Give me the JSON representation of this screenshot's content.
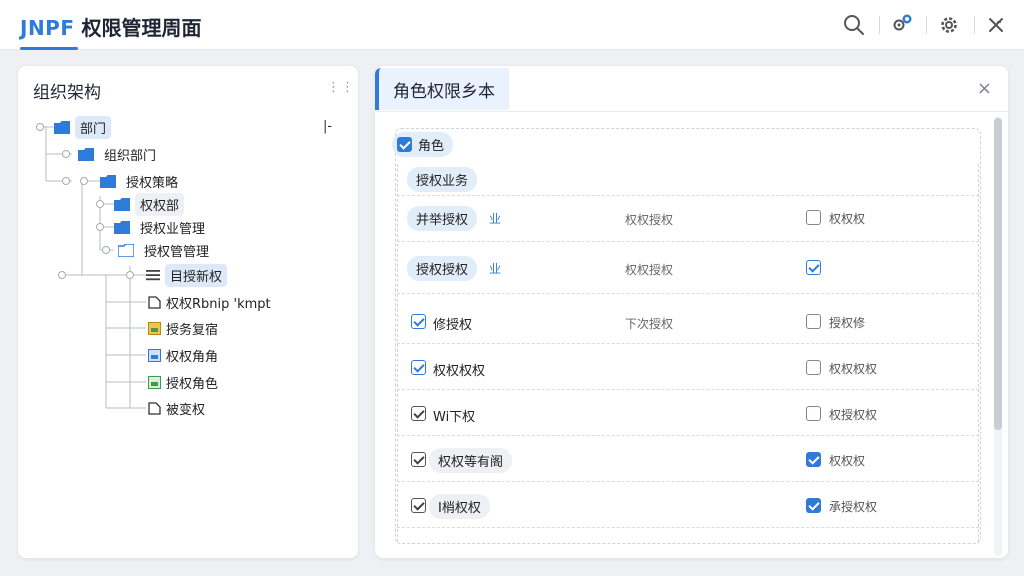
{
  "app": {
    "logo": "JNPF",
    "title": "权限管理周面"
  },
  "header_icons": [
    "search-icon",
    "notification-icon",
    "settings-icon",
    "collapse-icon"
  ],
  "left_panel": {
    "title": "组织架构",
    "more": "⋮⋮",
    "toggle": "|-",
    "nodes": [
      {
        "label": "部门",
        "icon": "folder-icon"
      },
      {
        "label": "组织部门",
        "icon": "folder-icon"
      },
      {
        "label": "授权策略",
        "icon": "folder-icon"
      },
      {
        "label": "权权部",
        "icon": "folder-icon"
      },
      {
        "label": "授权业管理",
        "icon": "folder-icon"
      },
      {
        "label": "授权管管理",
        "icon": "folder-open-icon"
      },
      {
        "label": "目授新权",
        "icon": "list-icon"
      },
      {
        "label": "权权Rbnip 'kmpt",
        "icon": "file-icon"
      },
      {
        "label": "授务复宿",
        "icon": "doc-yellow-icon"
      },
      {
        "label": "权权角角",
        "icon": "doc-blue-icon"
      },
      {
        "label": "授权角色",
        "icon": "doc-green-icon"
      },
      {
        "label": "被变权",
        "icon": "file-icon"
      }
    ]
  },
  "right_panel": {
    "title": "角色权限乡本",
    "close": "×",
    "root_checkbox": {
      "label": "角色",
      "checked": true
    },
    "section_label": "授权业务",
    "rows": [
      {
        "label": "并举授权",
        "suffix": "业",
        "mid": "权权授权",
        "right_checked": false,
        "right_label": "权权权",
        "style": "pill"
      },
      {
        "label": "授权授权",
        "suffix": "业",
        "mid": "权权授权",
        "right_checked": true,
        "right_label": "",
        "style": "pill"
      },
      {
        "label": "修授权",
        "suffix": "",
        "mid": "下次授权",
        "right_checked": false,
        "right_label": "授权修",
        "style": "cb-outline"
      },
      {
        "label": "权权权权",
        "suffix": "",
        "mid": "",
        "right_checked": false,
        "right_label": "权权权权",
        "style": "cb-outline"
      },
      {
        "label": "Wi下权",
        "suffix": "",
        "mid": "",
        "right_checked": false,
        "right_label": "权授权权",
        "style": "cb-dark"
      },
      {
        "label": "权权等有阁",
        "suffix": "",
        "mid": "",
        "right_checked": true,
        "right_label": "权权权",
        "style": "cb-dark"
      },
      {
        "label": "I梢权权",
        "suffix": "",
        "mid": "",
        "right_checked": true,
        "right_label": "承授权权",
        "style": "cb-dark"
      }
    ]
  },
  "colors": {
    "accent": "#2f7bd8",
    "pill": "#e2edfa",
    "background": "#eef0f3"
  }
}
